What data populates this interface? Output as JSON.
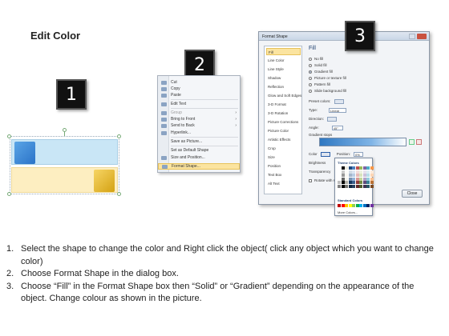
{
  "title": "Edit Color",
  "badges": [
    "1",
    "2",
    "3"
  ],
  "context_menu": {
    "items": [
      {
        "label": "Cut",
        "disabled": false,
        "submenu": false
      },
      {
        "label": "Copy",
        "disabled": false,
        "submenu": false
      },
      {
        "label": "Paste",
        "disabled": false,
        "submenu": false
      },
      {
        "label": "Edit Text",
        "disabled": false,
        "submenu": false
      },
      {
        "label": "Group",
        "disabled": true,
        "submenu": true
      },
      {
        "label": "Bring to Front",
        "disabled": false,
        "submenu": true
      },
      {
        "label": "Send to Back",
        "disabled": false,
        "submenu": true
      },
      {
        "label": "Hyperlink...",
        "disabled": false,
        "submenu": false
      },
      {
        "label": "Save as Picture...",
        "disabled": false,
        "submenu": false
      },
      {
        "label": "Set as Default Shape",
        "disabled": false,
        "submenu": false
      },
      {
        "label": "Size and Position...",
        "disabled": false,
        "submenu": false
      },
      {
        "label": "Format Shape...",
        "disabled": false,
        "submenu": false,
        "highlighted": true
      }
    ]
  },
  "dialog": {
    "title": "Format Shape",
    "categories": [
      "Fill",
      "Line Color",
      "Line Style",
      "Shadow",
      "Reflection",
      "Glow and Soft Edges",
      "3-D Format",
      "3-D Rotation",
      "Picture Corrections",
      "Picture Color",
      "Artistic Effects",
      "Crop",
      "Size",
      "Position",
      "Text Box",
      "Alt Text"
    ],
    "selected_category": "Fill",
    "pane_heading": "Fill",
    "fill_options": [
      "No fill",
      "Solid fill",
      "Gradient fill",
      "Picture or texture fill",
      "Pattern fill",
      "Slide background fill"
    ],
    "selected_fill": "Gradient fill",
    "preset_colors_label": "Preset colors:",
    "type_label": "Type:",
    "type_value": "Linear",
    "direction_label": "Direction:",
    "angle_label": "Angle:",
    "angle_value": "45°",
    "gradient_stops_label": "Gradient stops",
    "color_label": "Color",
    "position_label": "Position:",
    "position_value": "0%",
    "brightness_label": "Brightness",
    "transparency_label": "Transparency",
    "rotate_label": "Rotate with shape",
    "close_label": "Close"
  },
  "palette": {
    "theme_heading": "Theme Colors",
    "standard_heading": "Standard Colors",
    "more_label": "More Colors...",
    "theme_colors": [
      "#ffffff",
      "#000000",
      "#eeece1",
      "#1f497d",
      "#4f81bd",
      "#c0504d",
      "#9bbb59",
      "#8064a2",
      "#4bacc6",
      "#f79646"
    ],
    "standard_colors": [
      "#c00000",
      "#ff0000",
      "#ffc000",
      "#ffff00",
      "#92d050",
      "#00b050",
      "#00b0f0",
      "#0070c0",
      "#002060",
      "#7030a0"
    ]
  },
  "steps": [
    {
      "num": "1.",
      "text": "Select the shape to change the color and Right click the object( click any object which you want to change color)"
    },
    {
      "num": "2.",
      "text": "Choose Format Shape in the dialog box."
    },
    {
      "num": "3.",
      "text": "Choose “Fill” in the Format Shape box then “Solid” or “Gradient” depending on the appearance of the object. Change colour as shown in the picture."
    }
  ]
}
